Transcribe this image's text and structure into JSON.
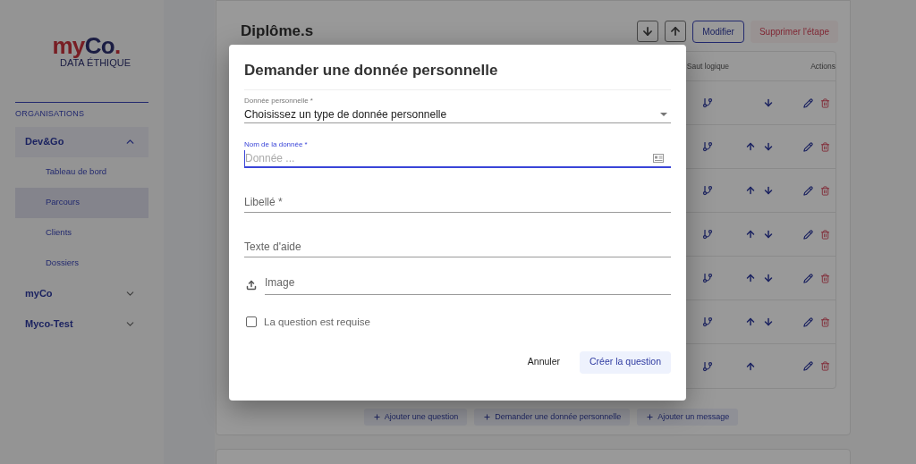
{
  "sidebar": {
    "logo": {
      "parts": [
        {
          "text": "my",
          "kind": "accent"
        },
        {
          "text": "Co",
          "kind": "main"
        },
        {
          "text": ".",
          "kind": "accent"
        }
      ],
      "tagline": "DATA ÉTHIQUE"
    },
    "heading": "ORGANISATIONS",
    "orgs": [
      {
        "label": "Dev&Go",
        "expanded": true,
        "children": [
          {
            "label": "Tableau de bord",
            "selected": false
          },
          {
            "label": "Parcours",
            "selected": true
          },
          {
            "label": "Clients",
            "selected": false
          },
          {
            "label": "Dossiers",
            "selected": false
          }
        ]
      },
      {
        "label": "myCo",
        "expanded": false
      },
      {
        "label": "Myco-Test",
        "expanded": false
      }
    ]
  },
  "step": {
    "title": "Diplôme.s",
    "edit_button": "Modifier",
    "delete_button": "Supprimer l'étape",
    "table": {
      "columns": [
        "Saut logique",
        "Actions"
      ],
      "rows": [
        {
          "up": false,
          "down": true
        },
        {
          "up": true,
          "down": true
        },
        {
          "up": true,
          "down": true
        },
        {
          "up": true,
          "down": true
        },
        {
          "up": true,
          "down": true
        },
        {
          "up": true,
          "down": true
        },
        {
          "up": true,
          "down": false
        }
      ]
    },
    "add_buttons": [
      "Ajouter une question",
      "Demander une donnée personnelle",
      "Ajouter un message"
    ]
  },
  "modal": {
    "title": "Demander une donnée personnelle",
    "fields": [
      {
        "kind": "select",
        "label": "Donnée personnelle *",
        "value": "Choisissez un type de donnée personnelle",
        "focused": false
      },
      {
        "kind": "text",
        "label": "Nom de la donnée *",
        "placeholder": "Donnée ...",
        "focused": true
      },
      {
        "kind": "text",
        "label": "Libellé *",
        "focused": false
      },
      {
        "kind": "text",
        "label": "Texte d'aide",
        "focused": false
      },
      {
        "kind": "file",
        "label": "Image",
        "focused": false
      }
    ],
    "checkbox": {
      "label": "La question est requise",
      "checked": false
    },
    "cancel": "Annuler",
    "submit": "Créer la question"
  }
}
